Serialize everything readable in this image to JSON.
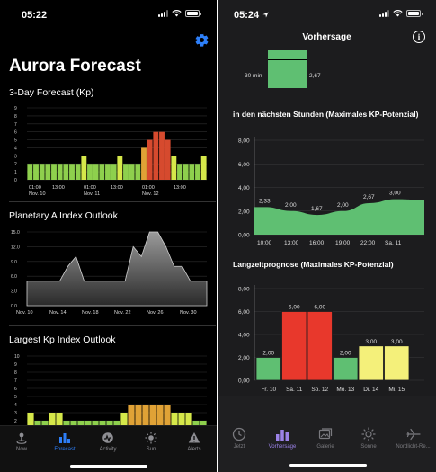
{
  "left": {
    "status": {
      "time": "05:22"
    },
    "title": "Aurora Forecast",
    "forecast3": {
      "title": "3-Day Forecast (Kp)",
      "yticks": [
        "9",
        "8",
        "7",
        "6",
        "5",
        "4",
        "3",
        "2",
        "1",
        "0"
      ],
      "xticks": [
        "01:00\nNov. 10",
        "13:00",
        "01:00\nNov. 11",
        "13:00",
        "01:00\nNov. 12",
        "13:00"
      ]
    },
    "aindex": {
      "title": "Planetary A Index Outlook",
      "yticks": [
        "15.0",
        "12.0",
        "9.0",
        "6.0",
        "3.0",
        "0.0"
      ],
      "xticks": [
        "Nov. 10",
        "Nov. 14",
        "Nov. 18",
        "Nov. 22",
        "Nov. 26",
        "Nov. 30"
      ]
    },
    "largestkp": {
      "title": "Largest Kp Index Outlook",
      "yticks": [
        "10",
        "9",
        "8",
        "7",
        "6",
        "5",
        "4",
        "3",
        "2",
        "1"
      ]
    },
    "tabs": [
      {
        "label": "Now",
        "icon": "location-pin-icon"
      },
      {
        "label": "Forecast",
        "icon": "bar-chart-icon"
      },
      {
        "label": "Activity",
        "icon": "activity-gauge-icon"
      },
      {
        "label": "Sun",
        "icon": "sun-icon"
      },
      {
        "label": "Alerts",
        "icon": "warning-icon"
      }
    ]
  },
  "right": {
    "status": {
      "time": "05:24"
    },
    "nav_title": "Vorhersage",
    "top_chart": {
      "label_left": "30 min",
      "value": "2,67"
    },
    "hours": {
      "title": "in den nächsten Stunden (Maximales KP-Potenzial)",
      "yticks": [
        "8,00",
        "6,00",
        "4,00",
        "2,00",
        "0,00"
      ],
      "xlabels": [
        "10:00",
        "13:00",
        "16:00",
        "19:00",
        "22:00",
        "Sa. 11"
      ],
      "value_labels": [
        "2,33",
        "2,00",
        "1,67",
        "2,00",
        "2,67",
        "3,00"
      ]
    },
    "longterm": {
      "title": "Langzeitprognose (Maximales KP-Potenzial)",
      "yticks": [
        "8,00",
        "6,00",
        "4,00",
        "2,00",
        "0,00"
      ],
      "xlabels": [
        "Fr. 10",
        "Sa. 11",
        "So. 12",
        "Mo. 13",
        "Di. 14",
        "Mi. 15"
      ],
      "value_labels": [
        "2,00",
        "6,00",
        "6,00",
        "2,00",
        "3,00",
        "3,00"
      ]
    },
    "tabs": [
      {
        "label": "Jetzt",
        "icon": "clock-icon"
      },
      {
        "label": "Vorhersage",
        "icon": "bar-chart-icon"
      },
      {
        "label": "Galerie",
        "icon": "gallery-icon"
      },
      {
        "label": "Sonne",
        "icon": "sun-icon"
      },
      {
        "label": "Nordlicht-Re...",
        "icon": "airplane-icon"
      }
    ]
  },
  "colors": {
    "kp_green": "#8ed04d",
    "kp_yellow": "#d6e84a",
    "kp_orange": "#e0a236",
    "kp_red": "#d64a2e",
    "accent_blue": "#2d7ff9",
    "accent_purple": "#9b82e8",
    "area_green": "#5fbf72",
    "bar_red": "#e8382c",
    "bar_yellow": "#f4f07a"
  },
  "chart_data": [
    {
      "type": "bar",
      "title": "3-Day Forecast (Kp)",
      "ylim": [
        0,
        9
      ],
      "values": [
        2,
        2,
        2,
        2,
        2,
        2,
        2,
        2,
        2,
        3,
        2,
        2,
        2,
        2,
        2,
        3,
        2,
        2,
        2,
        4,
        5,
        6,
        6,
        5,
        3,
        2,
        2,
        2,
        2,
        3
      ]
    },
    {
      "type": "area",
      "title": "Planetary A Index Outlook",
      "ylim": [
        0,
        15
      ],
      "values": [
        5,
        5,
        5,
        5,
        5,
        8,
        10,
        5,
        5,
        5,
        5,
        5,
        5,
        12,
        10,
        15,
        15,
        12,
        8,
        8,
        5,
        5,
        5
      ]
    },
    {
      "type": "bar",
      "title": "Largest Kp Index Outlook",
      "ylim": [
        1,
        10
      ],
      "values": [
        3,
        2,
        2,
        3,
        3,
        2,
        2,
        2,
        2,
        2,
        2,
        2,
        2,
        3,
        4,
        4,
        4,
        4,
        4,
        4,
        3,
        3,
        3,
        2,
        2
      ]
    },
    {
      "type": "area",
      "title": "in den nächsten Stunden (Maximales KP-Potenzial)",
      "categories": [
        "10:00",
        "13:00",
        "16:00",
        "19:00",
        "22:00",
        "Sa. 11"
      ],
      "values": [
        2.33,
        2.0,
        1.67,
        2.0,
        2.67,
        3.0
      ],
      "ylim": [
        0,
        8
      ]
    },
    {
      "type": "bar",
      "title": "Langzeitprognose (Maximales KP-Potenzial)",
      "categories": [
        "Fr. 10",
        "Sa. 11",
        "So. 12",
        "Mo. 13",
        "Di. 14",
        "Mi. 15"
      ],
      "values": [
        2,
        6,
        6,
        2,
        3,
        3
      ],
      "ylim": [
        0,
        8
      ]
    }
  ]
}
